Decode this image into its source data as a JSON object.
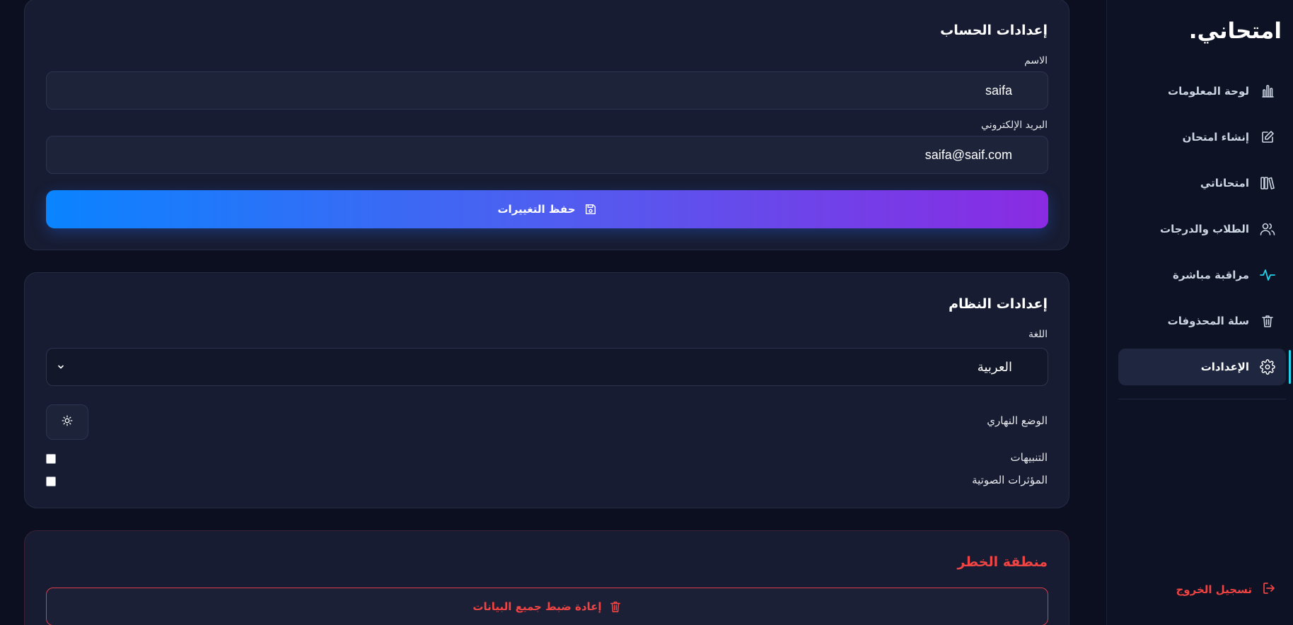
{
  "sidebar": {
    "brand": "امتحاني.",
    "items": [
      {
        "label": "لوحة المعلومات",
        "icon": "bar-chart-icon"
      },
      {
        "label": "إنشاء امتحان",
        "icon": "edit-icon"
      },
      {
        "label": "امتحاناتي",
        "icon": "library-icon"
      },
      {
        "label": "الطلاب والدرجات",
        "icon": "users-icon"
      },
      {
        "label": "مراقبة مباشرة",
        "icon": "activity-icon"
      },
      {
        "label": "سلة المحذوفات",
        "icon": "trash-icon"
      },
      {
        "label": "الإعدادات",
        "icon": "gear-icon",
        "active": true
      }
    ],
    "logout_label": "تسجيل الخروج"
  },
  "account": {
    "title": "إعدادات الحساب",
    "name_label": "الاسم",
    "name_value": "saifa",
    "email_label": "البريد الإلكتروني",
    "email_value": "saifa@saif.com",
    "save_label": "حفظ التغييرات"
  },
  "system": {
    "title": "إعدادات النظام",
    "language_label": "اللغة",
    "language_value": "العربية",
    "theme_label": "الوضع النهاري",
    "notifications_label": "التنبيهات",
    "notifications_checked": false,
    "sound_label": "المؤثرات الصوتية",
    "sound_checked": false
  },
  "danger": {
    "title": "منطقة الخطر",
    "reset_label": "إعادة ضبط جميع البيانات"
  },
  "colors": {
    "accent": "#22d3ee",
    "danger": "#ef4444",
    "gradient_start": "#0a84ff",
    "gradient_end": "#8a2be2"
  }
}
